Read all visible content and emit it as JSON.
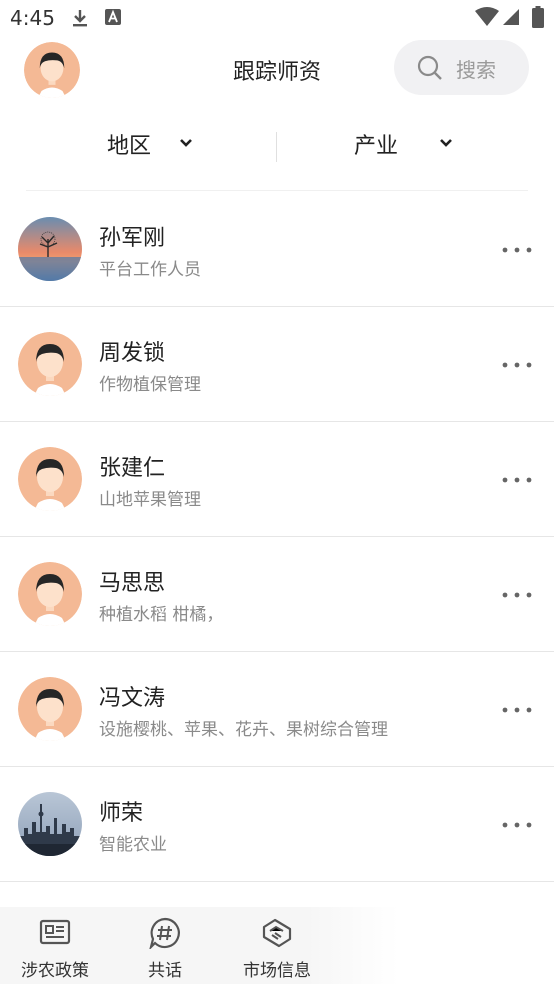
{
  "status_bar": {
    "time": "4:45"
  },
  "header": {
    "title": "跟踪师资",
    "search_label": "搜索"
  },
  "filters": [
    {
      "label": "地区"
    },
    {
      "label": "产业"
    }
  ],
  "experts": [
    {
      "name": "孙军刚",
      "desc": "平台工作人员",
      "avatar": "sunset-photo"
    },
    {
      "name": "周发锁",
      "desc": "作物植保管理",
      "avatar": "default-avatar"
    },
    {
      "name": "张建仁",
      "desc": "山地苹果管理",
      "avatar": "default-avatar"
    },
    {
      "name": "马思思",
      "desc": "种植水稻 柑橘，",
      "avatar": "default-avatar"
    },
    {
      "name": "冯文涛",
      "desc": "设施樱桃、苹果、花卉、果树综合管理",
      "avatar": "default-avatar"
    },
    {
      "name": "师荣",
      "desc": "智能农业",
      "avatar": "city-photo"
    }
  ],
  "tabs": [
    {
      "label": "涉农政策",
      "icon": "newspaper-icon"
    },
    {
      "label": "共话",
      "icon": "hashtag-chat-icon"
    },
    {
      "label": "市场信息",
      "icon": "handshake-icon"
    }
  ]
}
